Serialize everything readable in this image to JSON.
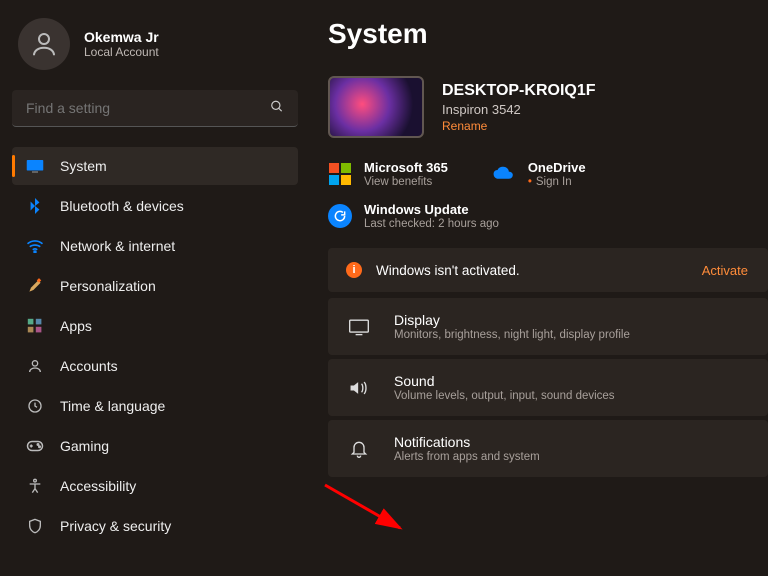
{
  "user": {
    "name": "Okemwa Jr",
    "account_type": "Local Account"
  },
  "search": {
    "placeholder": "Find a setting"
  },
  "nav": {
    "items": [
      {
        "label": "System",
        "active": true
      },
      {
        "label": "Bluetooth & devices"
      },
      {
        "label": "Network & internet"
      },
      {
        "label": "Personalization"
      },
      {
        "label": "Apps"
      },
      {
        "label": "Accounts"
      },
      {
        "label": "Time & language"
      },
      {
        "label": "Gaming"
      },
      {
        "label": "Accessibility"
      },
      {
        "label": "Privacy & security"
      }
    ]
  },
  "page_title": "System",
  "device": {
    "name": "DESKTOP-KROIQ1F",
    "model": "Inspiron 3542",
    "rename": "Rename"
  },
  "services": {
    "m365": {
      "title": "Microsoft 365",
      "sub": "View benefits"
    },
    "onedrive": {
      "title": "OneDrive",
      "sub": "Sign In"
    },
    "update": {
      "title": "Windows Update",
      "sub": "Last checked: 2 hours ago"
    }
  },
  "activation": {
    "message": "Windows isn't activated.",
    "action": "Activate"
  },
  "settings": [
    {
      "title": "Display",
      "sub": "Monitors, brightness, night light, display profile"
    },
    {
      "title": "Sound",
      "sub": "Volume levels, output, input, sound devices"
    },
    {
      "title": "Notifications",
      "sub": "Alerts from apps and system"
    }
  ]
}
